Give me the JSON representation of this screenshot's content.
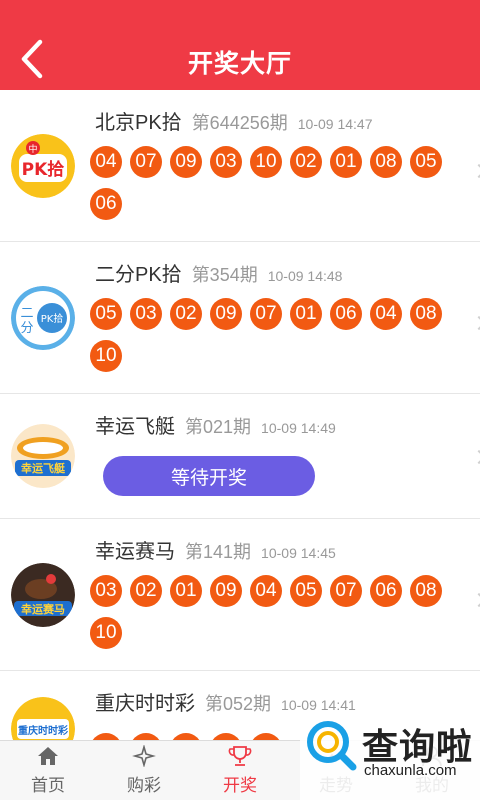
{
  "header": {
    "title": "开奖大厅",
    "color": "#ef3a45"
  },
  "lotteries": [
    {
      "name": "北京PK拾",
      "issue": "第644256期",
      "time": "10-09 14:47",
      "logo_text": "PK拾",
      "logo_badge": "中",
      "numbers": [
        "04",
        "07",
        "09",
        "03",
        "10",
        "02",
        "01",
        "08",
        "05",
        "06"
      ]
    },
    {
      "name": "二分PK拾",
      "issue": "第354期",
      "time": "10-09 14:48",
      "logo_text_1": "二",
      "logo_text_2": "分",
      "logo_badge": "PK拾",
      "numbers": [
        "05",
        "03",
        "02",
        "09",
        "07",
        "01",
        "06",
        "04",
        "08",
        "10"
      ]
    },
    {
      "name": "幸运飞艇",
      "issue": "第021期",
      "time": "10-09 14:49",
      "logo_text": "幸运飞艇",
      "button_label": "等待开奖"
    },
    {
      "name": "幸运赛马",
      "issue": "第141期",
      "time": "10-09 14:45",
      "logo_text": "幸运赛马",
      "numbers": [
        "03",
        "02",
        "01",
        "09",
        "04",
        "05",
        "07",
        "06",
        "08",
        "10"
      ]
    },
    {
      "name": "重庆时时彩",
      "issue": "第052期",
      "time": "10-09 14:41",
      "logo_text": "重庆时时彩"
    }
  ],
  "tabbar": {
    "items": [
      {
        "label": "首页",
        "icon": "home-icon"
      },
      {
        "label": "购彩",
        "icon": "sparkle-icon"
      },
      {
        "label": "开奖",
        "icon": "trophy-icon",
        "active": true
      },
      {
        "label": "走势",
        "icon": "trend-icon"
      },
      {
        "label": "我的",
        "icon": "user-icon"
      }
    ],
    "active_color": "#ef3a45"
  },
  "watermark": {
    "title": "查询啦",
    "subtitle": "chaxunla.com"
  },
  "colors": {
    "ball": "#f25a12",
    "wait_button": "#6b5de3"
  }
}
